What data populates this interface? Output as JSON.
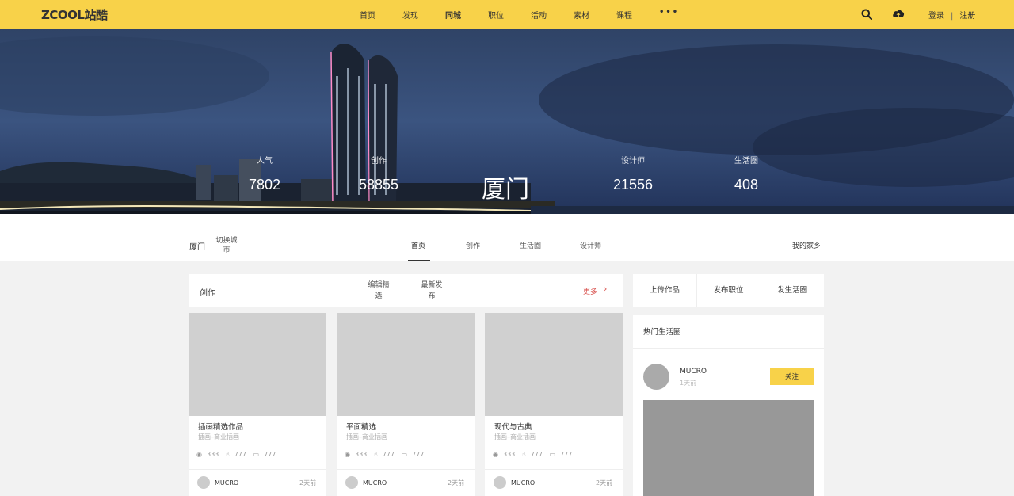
{
  "header": {
    "logo": "ZCOOL站酷",
    "nav": [
      "首页",
      "发现",
      "同城",
      "职位",
      "活动",
      "素材",
      "课程"
    ],
    "nav_active": "同城",
    "more": "•••",
    "search_icon": "search-icon",
    "upload_icon": "cloud-upload-icon",
    "login": "登录",
    "separator": "|",
    "register": "注册",
    "accent_color": "#f8d249"
  },
  "hero": {
    "city": "厦门",
    "stats": [
      {
        "label": "人气",
        "value": "7802"
      },
      {
        "label": "创作",
        "value": "58855"
      },
      {
        "label": "设计师",
        "value": "21556"
      },
      {
        "label": "生活圈",
        "value": "408"
      }
    ]
  },
  "subnav": {
    "city": "厦门",
    "switch": "切换城市",
    "tabs": [
      "首页",
      "创作",
      "生活圈",
      "设计师"
    ],
    "active_tab": "首页",
    "hometown": "我的家乡"
  },
  "creation": {
    "title": "创作",
    "tabs": [
      "编辑精选",
      "最新发布"
    ],
    "more": "更多",
    "more_icon": "chevron-right-icon",
    "cards": [
      {
        "title": "插画精选作品",
        "category": "插画–商业插画",
        "views": "333",
        "likes": "777",
        "comments": "777",
        "author": "MUCRO",
        "time": "2天前"
      },
      {
        "title": "平面精选",
        "category": "插画–商业插画",
        "views": "333",
        "likes": "777",
        "comments": "777",
        "author": "MUCRO",
        "time": "2天前"
      },
      {
        "title": "现代与古典",
        "category": "插画–商业插画",
        "views": "333",
        "likes": "777",
        "comments": "777",
        "author": "MUCRO",
        "time": "2天前"
      }
    ]
  },
  "sidebar": {
    "actions": [
      "上传作品",
      "发布职位",
      "发生活圈"
    ],
    "hot_title": "热门生活圈",
    "post": {
      "name": "MUCRO",
      "time": "1天前",
      "follow": "关注"
    }
  }
}
